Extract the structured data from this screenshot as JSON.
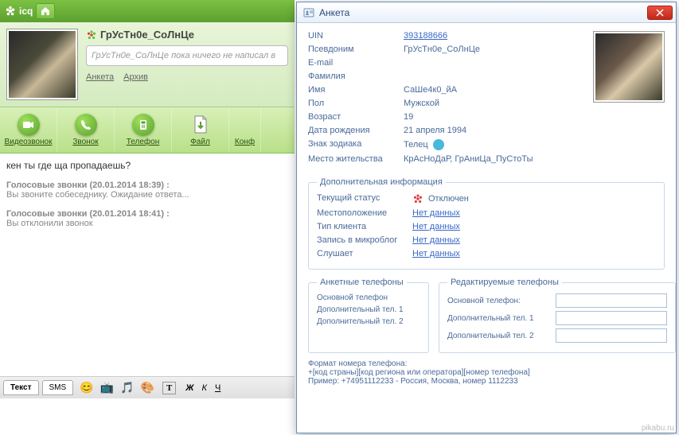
{
  "app": {
    "title": "icq"
  },
  "contact": {
    "name": "ГрУсТн0е_СоЛнЦе",
    "status_placeholder": "ГрУсТн0е_СоЛнЦе пока ничего не написал в",
    "link_profile": "Анкета",
    "link_archive": "Архив"
  },
  "toolbar": {
    "video": "Видеозвонок",
    "call": "Звонок",
    "phone": "Телефон",
    "file": "Файл",
    "conf": "Конф"
  },
  "chat": {
    "msg1": "кен ты где ща пропадаешь?",
    "call1_title": "Голосовые звонки (20.01.2014 18:39) :",
    "call1_body": "Вы звоните собеседнику. Ожидание ответа...",
    "call2_title": "Голосовые звонки (20.01.2014 18:41) :",
    "call2_body": "Вы отклонили звонок"
  },
  "input_tabs": {
    "text": "Текст",
    "sms": "SMS"
  },
  "profile": {
    "window_title": "Анкета",
    "labels": {
      "uin": "UIN",
      "nick": "Псевдоним",
      "email": "E-mail",
      "lastname": "Фамилия",
      "firstname": "Имя",
      "gender": "Пол",
      "age": "Возраст",
      "birthdate": "Дата рождения",
      "zodiac": "Знак зодиака",
      "location": "Место жительства"
    },
    "values": {
      "uin": "393188666",
      "nick": "ГрУсТн0е_СоЛнЦе",
      "firstname": "СаШе4к0_йА",
      "gender": "Мужской",
      "age": "19",
      "birthdate": "21 апреля 1994",
      "zodiac": "Телец",
      "location": "КрАсНоДаР, ГрАниЦа_ПуСтоТы"
    },
    "extra": {
      "legend": "Дополнительная информация",
      "status_label": "Текущий статус",
      "status_value": "Отключен",
      "loc_label": "Местоположение",
      "client_label": "Тип клиента",
      "microblog_label": "Запись в микроблог",
      "listens_label": "Слушает",
      "no_data": "Нет данных"
    },
    "phones": {
      "legend_left": "Анкетные телефоны",
      "legend_right": "Редактируемые телефоны",
      "main": "Основной телефон",
      "main_colon": "Основной телефон:",
      "add1": "Дополнительный тел. 1",
      "add2": "Дополнительный тел. 2"
    },
    "format": {
      "line1": "Формат номера телефона:",
      "line2": "+[код страны][код региона или оператора][номер телефона]",
      "line3": "Пример: +74951112233 - Россия, Москва, номер 1112233"
    }
  },
  "watermark": "pikabu.ru"
}
